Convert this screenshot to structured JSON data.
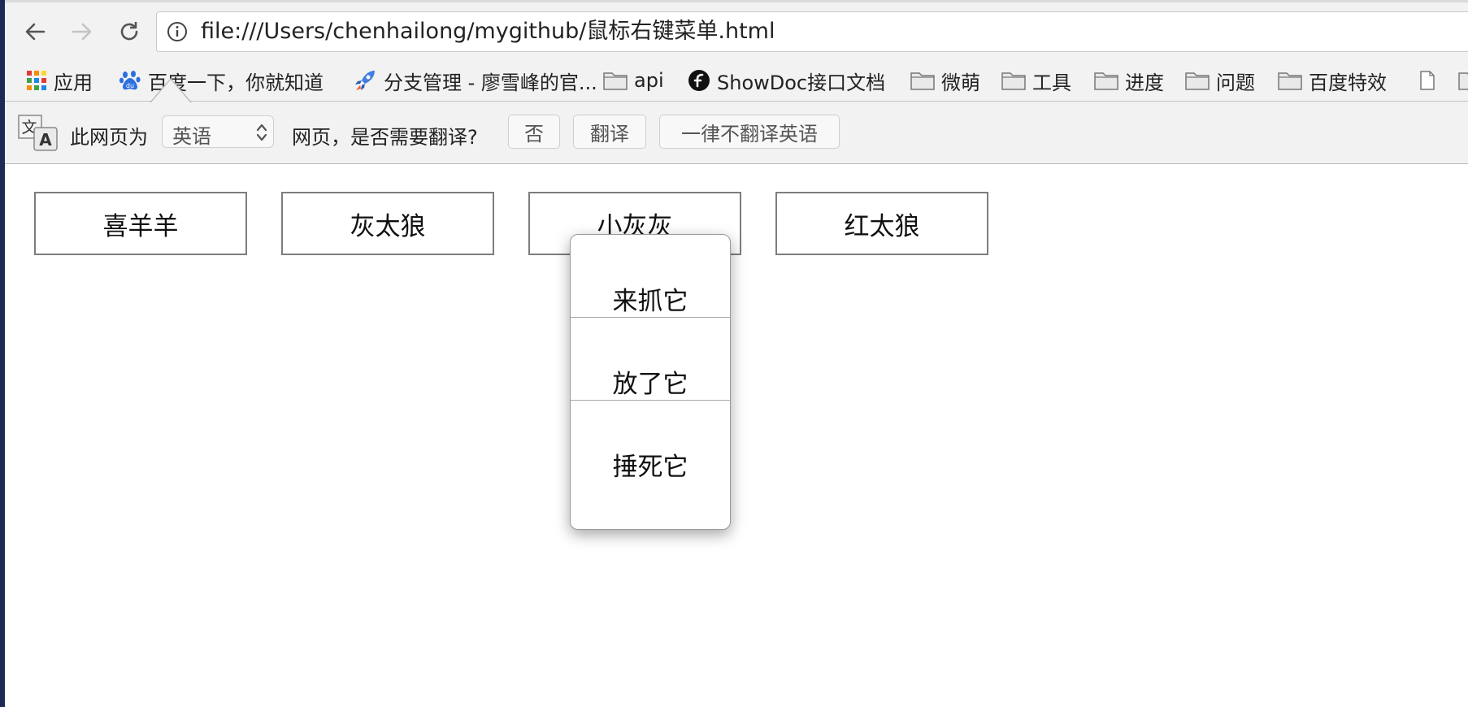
{
  "browser": {
    "url": "file:///Users/chenhailong/mygithub/鼠标右键菜单.html"
  },
  "bookmarks": [
    {
      "label": "应用",
      "icon": "apps-grid-icon"
    },
    {
      "label": "百度一下，你就知道",
      "icon": "baidu-paw-icon"
    },
    {
      "label": "分支管理 - 廖雪峰的官...",
      "icon": "rocket-icon"
    },
    {
      "label": "api",
      "icon": "folder-icon"
    },
    {
      "label": "ShowDoc接口文档",
      "icon": "showdoc-icon"
    },
    {
      "label": "微萌",
      "icon": "folder-icon"
    },
    {
      "label": "工具",
      "icon": "folder-icon"
    },
    {
      "label": "进度",
      "icon": "folder-icon"
    },
    {
      "label": "问题",
      "icon": "folder-icon"
    },
    {
      "label": "百度特效",
      "icon": "folder-icon"
    }
  ],
  "translate_bar": {
    "prefix": "此网页为",
    "language": "英语",
    "question": "网页，是否需要翻译?",
    "no_label": "否",
    "translate_label": "翻译",
    "never_label": "一律不翻译英语"
  },
  "cards": [
    {
      "label": "喜羊羊"
    },
    {
      "label": "灰太狼"
    },
    {
      "label": "小灰灰"
    },
    {
      "label": "红太狼"
    }
  ],
  "context_menu": {
    "items": [
      {
        "label": "来抓它"
      },
      {
        "label": "放了它"
      },
      {
        "label": "捶死它"
      }
    ]
  }
}
